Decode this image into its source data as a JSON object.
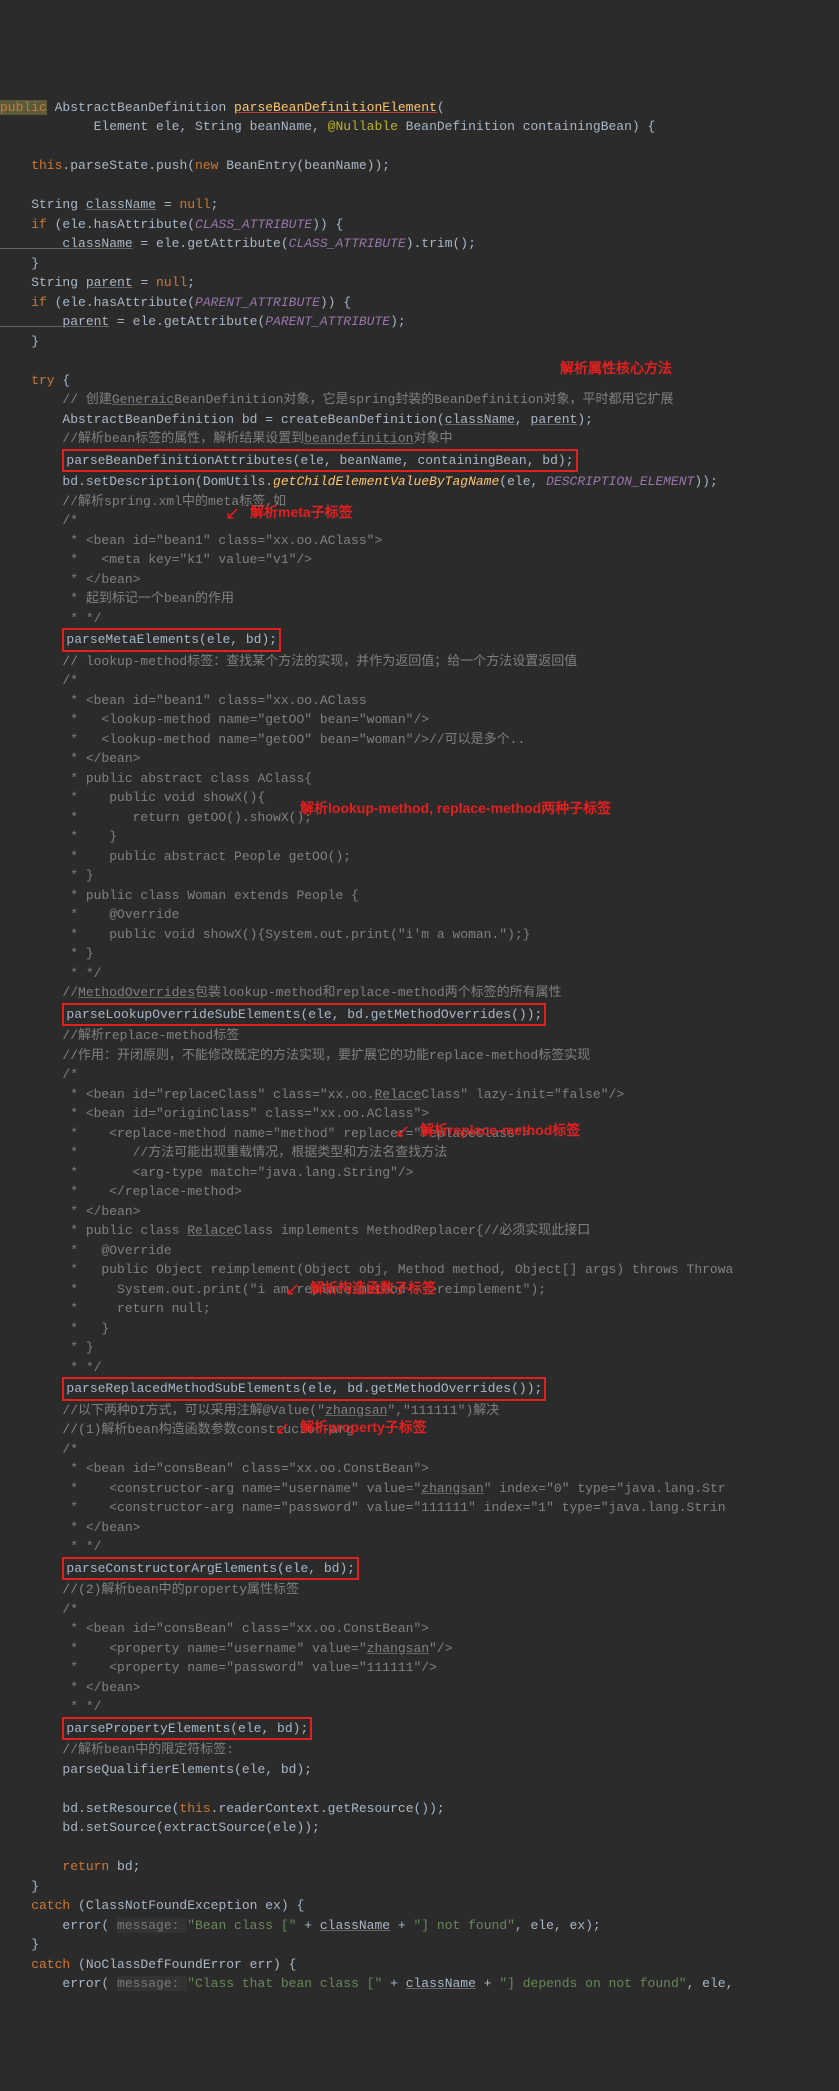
{
  "code": {
    "sig1": "public",
    "sig2": " AbstractBeanDefinition ",
    "sig3": "parseBeanDefinitionElement",
    "sig4": "(",
    "sig5": "            Element ele, String beanName, ",
    "sig_ann": "@Nullable",
    "sig6": " BeanDefinition containingBean) {",
    "l3a": "    this",
    "l3b": ".parseState.push(",
    "l3c": "new",
    "l3d": " BeanEntry(beanName));",
    "l5a": "    String ",
    "l5b": "className",
    "l5c": " = ",
    "l5d": "null",
    "l5e": ";",
    "l6a": "    if",
    "l6b": " (ele.hasAttribute(",
    "l6c": "CLASS_ATTRIBUTE",
    "l6d": ")) {",
    "l7a": "        className",
    "l7b": " = ele.getAttribute(",
    "l7c": "CLASS_ATTRIBUTE",
    "l7d": ").trim();",
    "l8": "    }",
    "l9a": "    String ",
    "l9b": "parent",
    "l9c": " = ",
    "l9d": "null",
    "l9e": ";",
    "l10a": "    if",
    "l10b": " (ele.hasAttribute(",
    "l10c": "PARENT_ATTRIBUTE",
    "l10d": ")) {",
    "l11a": "        parent",
    "l11b": " = ele.getAttribute(",
    "l11c": "PARENT_ATTRIBUTE",
    "l11d": ");",
    "l12": "    }",
    "try": "    try",
    "try2": " {",
    "c1": "        // 创建",
    "c1b": "Generaic",
    "c1c": "BeanDefinition对象，它是spring封装的BeanDefinition对象，平时都用它扩展",
    "l15a": "        AbstractBeanDefinition bd = createBeanDefinition(",
    "l15b": "className",
    "l15c": ", ",
    "l15d": "parent",
    "l15e": ");",
    "c2": "        //解析bean标签的属性，解析结果设置到",
    "c2b": "beandefinition",
    "c2c": "对象中",
    "box1": "parseBeanDefinitionAttributes(ele, beanName, containingBean, bd);",
    "l17a": "        bd.setDescription(DomUtils.",
    "l17b": "getChildElementValueByTagName",
    "l17c": "(ele, ",
    "l17d": "DESCRIPTION_ELEMENT",
    "l17e": "));",
    "c3": "        //解析spring.xml中的meta标签,如",
    "c4": "        /*",
    "c5": "         * <bean id=\"bean1\" class=\"xx.oo.AClass\">",
    "c6": "         *   <meta key=\"k1\" value=\"v1\"/>",
    "c7": "         * </bean>",
    "c8": "         * 起到标记一个bean的作用",
    "c9": "         * */",
    "box2": "parseMetaElements(ele, bd);",
    "c10": "        // lookup-method标签：查找某个方法的实现，并作为返回值；给一个方法设置返回值",
    "c11": "        /*",
    "c12": "         * <bean id=\"bean1\" class=\"xx.oo.AClass",
    "c13": "         *   <lookup-method name=\"getOO\" bean=\"woman\"/>",
    "c14": "         *   <lookup-method name=\"getOO\" bean=\"woman\"/>//可以是多个..",
    "c15": "         * </bean>",
    "c16": "         * public abstract class AClass{",
    "c17": "         *    public void showX(){",
    "c18": "         *       return getOO().showX();",
    "c19": "         *    }",
    "c20": "         *    public abstract People getOO();",
    "c21": "         * }",
    "c22": "         * public class Woman extends People {",
    "c23": "         *    @Override",
    "c24": "         *    public void showX(){System.out.print(\"i'm a woman.\");}",
    "c25": "         * }",
    "c26": "         * */",
    "c27a": "        //",
    "c27b": "MethodOverrides",
    "c27c": "包装lookup-method和replace-method两个标签的所有属性",
    "box3": "parseLookupOverrideSubElements(ele, bd.getMethodOverrides());",
    "c28": "        //解析replace-method标签",
    "c29": "        //作用：开闭原则，不能修改既定的方法实现，要扩展它的功能replace-method标签实现",
    "c30": "        /*",
    "c31a": "         * <bean id=\"replaceClass\" class=\"xx.oo.",
    "c31b": "Relace",
    "c31c": "Class\" lazy-init=\"false\"/>",
    "c32": "         * <bean id=\"originClass\" class=\"xx.oo.AClass\">",
    "c33": "         *    <replace-method name=\"method\" replacer=\"replaceClass\">",
    "c34": "         *       //方法可能出现重载情况，根据类型和方法名查找方法",
    "c35": "         *       <arg-type match=\"java.lang.String\"/>",
    "c36": "         *    </replace-method>",
    "c37": "         * </bean>",
    "c38a": "         * public class ",
    "c38b": "Relace",
    "c38c": "Class implements MethodReplacer{//必须实现此接口",
    "c39": "         *   @Override",
    "c40": "         *   public Object reimplement(Object obj, Method method, Object[] args) throws Throwa",
    "c41": "         *     System.out.print(\"i am replace-method--->reimplement\");",
    "c42": "         *     return null;",
    "c43": "         *   }",
    "c44": "         * }",
    "c45": "         * */",
    "box4": "parseReplacedMethodSubElements(ele, bd.getMethodOverrides());",
    "c46a": "        //以下两种DI方式，可以采用注解@Value(\"",
    "c46b": "zhangsan",
    "c46c": "\",\"111111\")解决",
    "c47": "        //(1)解析bean构造函数参数constructor-arg",
    "c48": "        /*",
    "c49": "         * <bean id=\"consBean\" class=\"xx.oo.ConstBean\">",
    "c50a": "         *    <constructor-arg name=\"username\" value=\"",
    "c50b": "zhangsan",
    "c50c": "\" index=\"0\" type=\"java.lang.Str",
    "c51": "         *    <constructor-arg name=\"password\" value=\"111111\" index=\"1\" type=\"java.lang.Strin",
    "c52": "         * </bean>",
    "c53": "         * */",
    "box5": "parseConstructorArgElements(ele, bd);",
    "c54": "        //(2)解析bean中的property属性标签",
    "c55": "        /*",
    "c56": "         * <bean id=\"consBean\" class=\"xx.oo.ConstBean\">",
    "c57a": "         *    <property name=\"username\" value=\"",
    "c57b": "zhangsan",
    "c57c": "\"/>",
    "c58": "         *    <property name=\"password\" value=\"111111\"/>",
    "c59": "         * </bean>",
    "c60": "         * */",
    "box6": "parsePropertyElements(ele, bd);",
    "c61": "        //解析bean中的限定符标签:",
    "l62": "        parseQualifierElements(ele, bd);",
    "l64a": "        bd.setResource(",
    "l64b": "this",
    "l64c": ".readerContext.getResource());",
    "l65": "        bd.setSource(extractSource(ele));",
    "l67a": "        return",
    "l67b": " bd;",
    "l68": "    }",
    "l69a": "    catch",
    "l69b": " (ClassNotFoundException ex) {",
    "l70a": "        error( ",
    "l70h": "message: ",
    "l70b": "\"Bean class [\"",
    "l70c": " + ",
    "l70d": "className",
    "l70e": " + ",
    "l70f": "\"] not found\"",
    "l70g": ", ele, ex);",
    "l71": "    }",
    "l72a": "    catch",
    "l72b": " (NoClassDefFoundError err) {",
    "l73a": "        error( ",
    "l73h": "message: ",
    "l73b": "\"Class that bean class [\"",
    "l73c": " + ",
    "l73d": "className",
    "l73e": " + ",
    "l73f": "\"] depends on not found\"",
    "l73g": ", ele,"
  },
  "labels": {
    "a1": "解析属性核心方法",
    "a2": "解析meta子标签",
    "a3": "解析lookup-method, replace-method两种子标签",
    "a4": "解析replace-method标签",
    "a5": "解析构造函数子标签",
    "a6": "解析property子标签"
  }
}
